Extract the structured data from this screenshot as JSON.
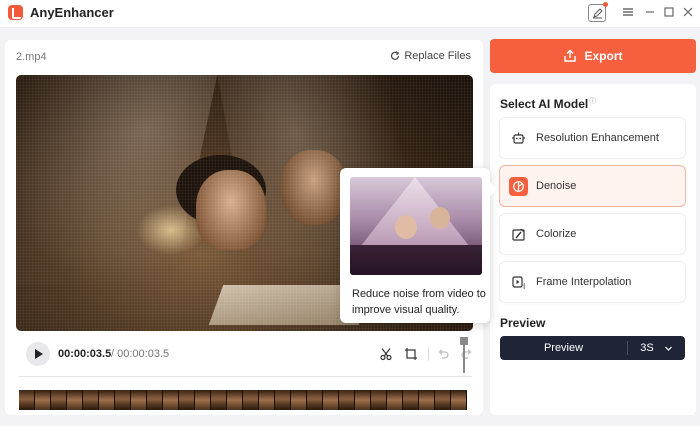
{
  "app": {
    "title": "AnyEnhancer"
  },
  "workspace": {
    "file_name": "2.mp4",
    "replace_files_label": "Replace Files"
  },
  "tooltip": {
    "description": "Reduce noise from video to improve visual quality."
  },
  "player": {
    "current_time": "00:00:03.5",
    "total_time": "/ 00:00:03.5"
  },
  "export": {
    "label": "Export"
  },
  "ai_models": {
    "title": "Select AI Model",
    "info_mark": "ⓘ",
    "items": [
      {
        "label": "Resolution Enhancement",
        "icon": "robot-icon",
        "selected": false
      },
      {
        "label": "Denoise",
        "icon": "denoise-icon",
        "selected": true
      },
      {
        "label": "Colorize",
        "icon": "colorize-icon",
        "selected": false
      },
      {
        "label": "Frame Interpolation",
        "icon": "frame-interpolation-icon",
        "selected": false
      }
    ]
  },
  "preview": {
    "title": "Preview",
    "button_label": "Preview",
    "duration": "3S"
  },
  "colors": {
    "accent": "#f7603f",
    "dark_button": "#1f2537",
    "selected_card_bg": "#fff3ef"
  }
}
